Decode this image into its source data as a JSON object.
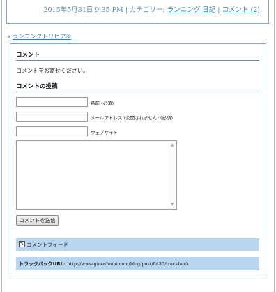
{
  "post_meta": {
    "date": "2015年5月31日 9:35 PM",
    "separator1": " | ",
    "category_prefix": "カテゴリー: ",
    "category": "ランニング 日記",
    "separator2": " | ",
    "comments_link": "コメント (2)"
  },
  "prev_nav": {
    "arrow": "« ",
    "link": "ランニングトリビア⑥"
  },
  "comments": {
    "title": "コメント",
    "message": "コメントをお寄せください。"
  },
  "form": {
    "title": "コメントの投稿",
    "name_label": "名前 (必須)",
    "email_label": "メールアドレス (公開されません) (必須)",
    "website_label": "ウェブサイト",
    "submit_label": "コメントを送信"
  },
  "feed": {
    "label": "コメントフィード"
  },
  "trackback": {
    "label": "トラックバックURL: ",
    "url": "http://www.ginoshatai.com/blog/post/8435/trackback"
  }
}
